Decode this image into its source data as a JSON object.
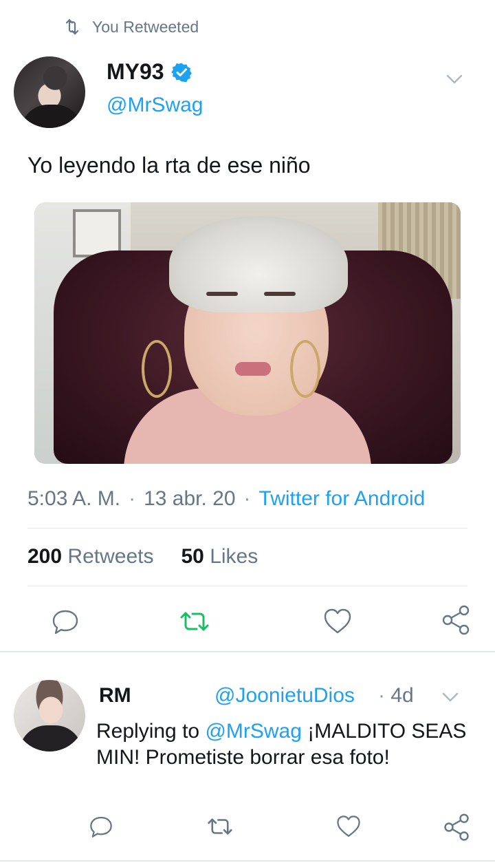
{
  "retweet_context": {
    "label": "You Retweeted"
  },
  "tweet": {
    "author_name": "MY93",
    "author_handle": "@MrSwag",
    "text": "Yo leyendo la rta de ese niño",
    "time": "5:03 A. M.",
    "date": "13 abr. 20",
    "source": "Twitter for Android",
    "retweets_count": "200",
    "retweets_label": "Retweets",
    "likes_count": "50",
    "likes_label": "Likes",
    "retweeted": true
  },
  "reply": {
    "author_name": "RM",
    "author_handle": "@JoonietuDios",
    "time": "4d",
    "replying_prefix": "Replying to",
    "replying_to": "@MrSwag",
    "text": "¡MALDITO SEAS MIN! Prometiste borrar esa foto!"
  },
  "icons": {
    "retweet": "retweet-icon",
    "reply": "reply-icon",
    "like": "heart-icon",
    "share": "share-icon",
    "verified": "verified-badge-icon",
    "chevron": "chevron-down-icon"
  },
  "colors": {
    "link": "#1da1f2",
    "secondary_text": "#657786",
    "retweet_active": "#17bf63",
    "divider": "#e1e8ed"
  }
}
